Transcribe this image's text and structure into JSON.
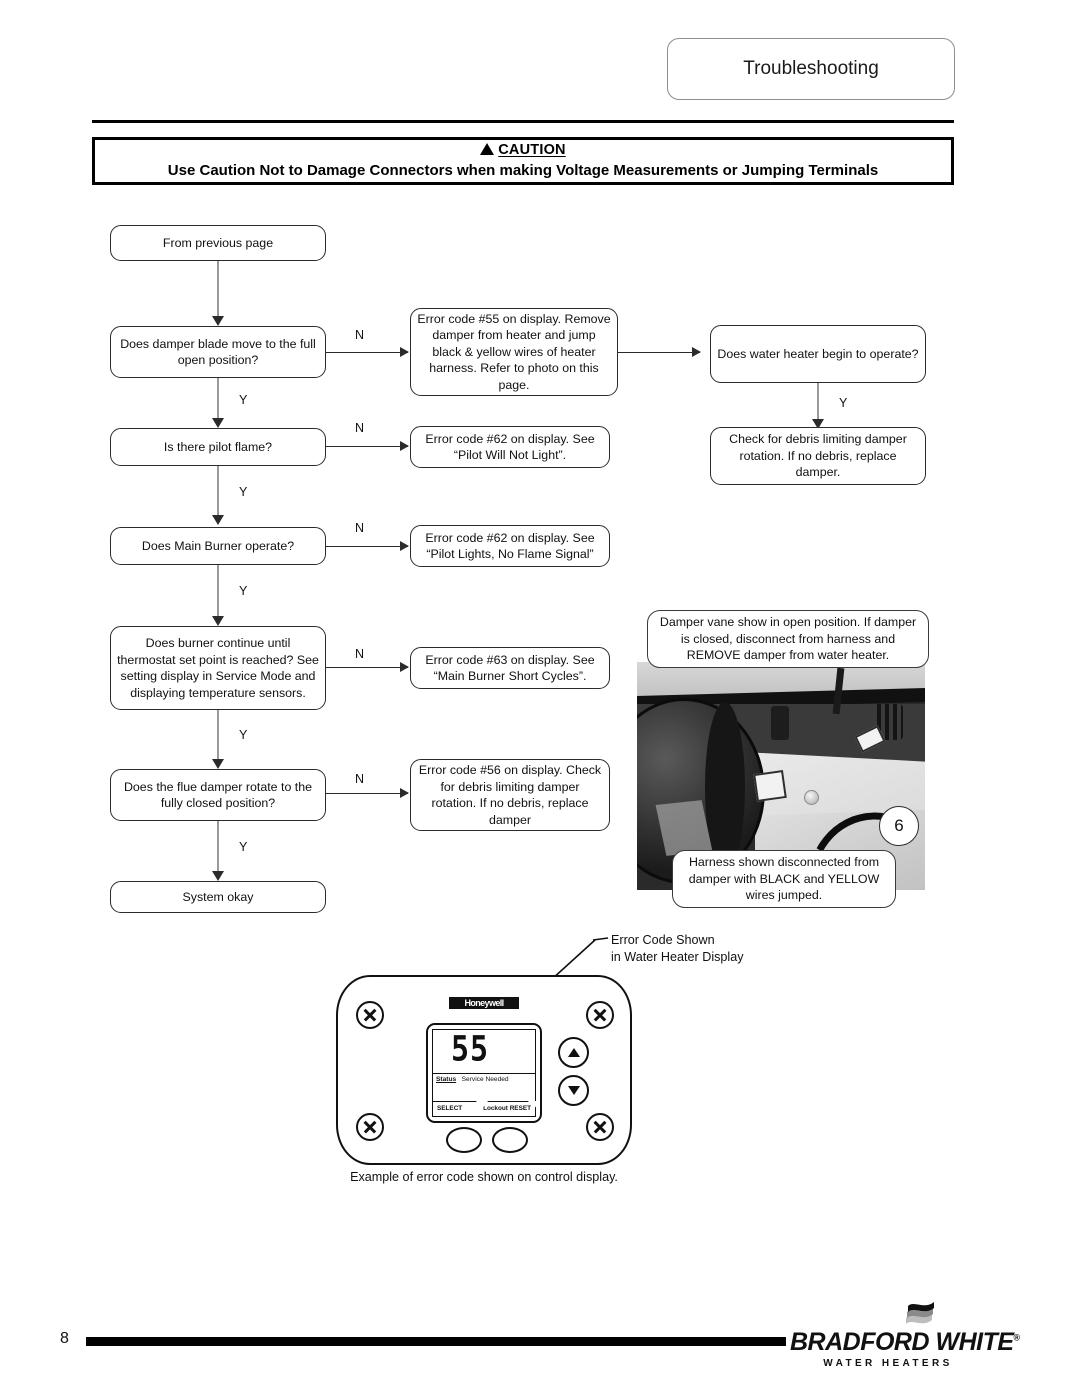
{
  "header": {
    "tab_title": "Troubleshooting"
  },
  "caution": {
    "heading": "CAUTION",
    "body": "Use Caution Not to Damage Connectors when making Voltage Measurements or Jumping Terminals"
  },
  "flow": {
    "start": "From previous page",
    "q1": "Does damper blade move to the full open position?",
    "q2": "Is there pilot flame?",
    "q3": "Does Main Burner operate?",
    "q4": "Does burner continue until thermostat set point is reached? See setting display in Service Mode and displaying temperature sensors.",
    "q5": "Does the flue damper rotate to the fully closed position?",
    "end": "System okay",
    "e1": "Error code #55 on display. Remove damper from heater and jump black & yellow wires of heater harness.  Refer to photo on this page.",
    "e2": "Error code #62 on display.  See “Pilot Will Not Light”.",
    "e3": "Error code #62 on display.  See “Pilot Lights, No Flame Signal”",
    "e4": "Error code #63 on display.  See “Main Burner Short Cycles”.",
    "e5": "Error code #56 on display. Check for debris limiting damper rotation.  If no debris, replace damper",
    "r1": "Does water heater begin to operate?",
    "r2": "Check for debris limiting damper rotation.  If no debris, replace damper.",
    "branch_no": "N",
    "branch_yes": "Y"
  },
  "photo": {
    "top_caption": "Damper vane show in open position. If damper is closed, disconnect from harness and REMOVE damper from water heater.",
    "bottom_caption": "Harness shown disconnected from damper with BLACK and YELLOW wires jumped.",
    "badge": "6"
  },
  "control": {
    "leader_line1": "Error Code Shown",
    "leader_line2": "in Water Heater Display",
    "brand": "Honeywell",
    "lcd_code": "55",
    "status_label": "Status",
    "status_value": "Service Needed",
    "softkey_left": "SELECT",
    "softkey_right": "Lockout RESET",
    "caption": "Example of error code shown on control display."
  },
  "footer": {
    "page_number": "8",
    "brand_name": "BRADFORD WHITE",
    "brand_reg": "®",
    "brand_sub": "WATER HEATERS"
  }
}
